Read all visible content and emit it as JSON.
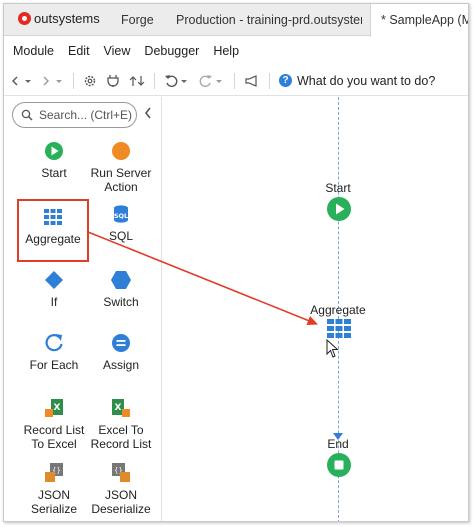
{
  "app": {
    "logo_text": "outsystems",
    "tabs": [
      {
        "label": "Forge"
      },
      {
        "label": "Production - training-prd.outsystem..."
      },
      {
        "label": "* SampleApp (My"
      }
    ]
  },
  "menu": [
    "Module",
    "Edit",
    "View",
    "Debugger",
    "Help"
  ],
  "toolbar": {
    "help_text": "What do you want to do?"
  },
  "toolbox": {
    "search_placeholder": "Search... (Ctrl+E)",
    "tools": [
      {
        "label": "Start",
        "icon": "start-icon"
      },
      {
        "label": "Run Server Action",
        "icon": "run-server-action-icon"
      },
      {
        "label": "Aggregate",
        "icon": "aggregate-icon",
        "selected": true
      },
      {
        "label": "SQL",
        "icon": "sql-icon"
      },
      {
        "label": "If",
        "icon": "if-icon"
      },
      {
        "label": "Switch",
        "icon": "switch-icon"
      },
      {
        "label": "For Each",
        "icon": "for-each-icon"
      },
      {
        "label": "Assign",
        "icon": "assign-icon"
      },
      {
        "label": "Record List To Excel",
        "icon": "record-list-to-excel-icon"
      },
      {
        "label": "Excel To Record List",
        "icon": "excel-to-record-list-icon"
      },
      {
        "label": "JSON Serialize",
        "icon": "json-serialize-icon"
      },
      {
        "label": "JSON Deserialize",
        "icon": "json-deserialize-icon"
      }
    ]
  },
  "canvas": {
    "nodes": [
      {
        "label": "Start"
      },
      {
        "label": "Aggregate"
      },
      {
        "label": "End"
      }
    ]
  },
  "colors": {
    "start_green": "#28b15a",
    "action_orange": "#f08a24",
    "blue": "#2f7fd6",
    "highlight_red": "#e03c28",
    "excel_green": "#2f8f4a",
    "json_orange": "#e08a2a"
  }
}
